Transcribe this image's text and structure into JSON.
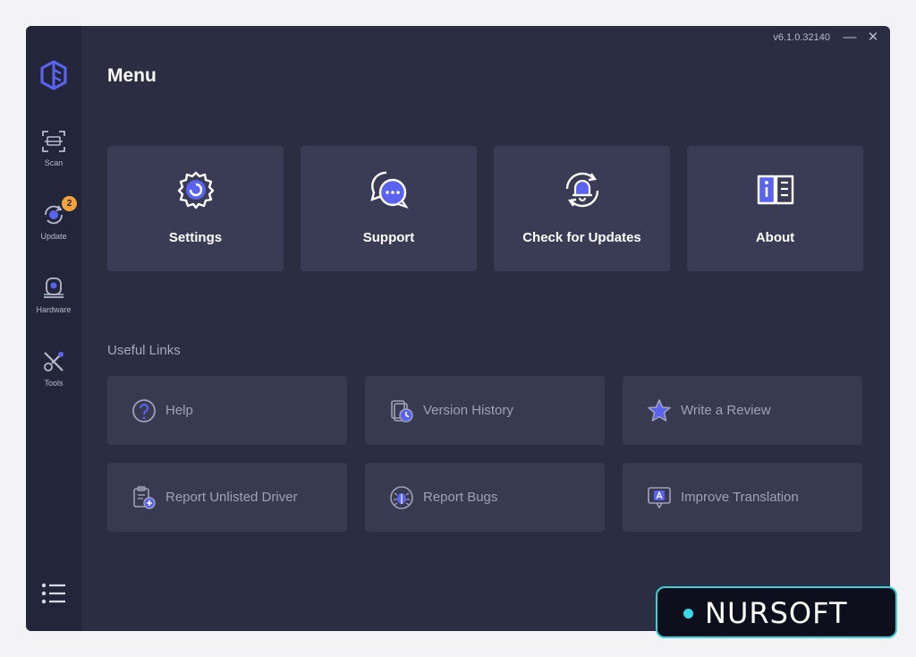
{
  "app": {
    "version": "v6.1.0.32140",
    "accent": "#5a63f0",
    "badge_color": "#f2a33a"
  },
  "sidebar": {
    "items": [
      {
        "label": "Scan",
        "icon": "scan-icon"
      },
      {
        "label": "Update",
        "icon": "update-icon",
        "badge": "2"
      },
      {
        "label": "Hardware",
        "icon": "hardware-icon"
      },
      {
        "label": "Tools",
        "icon": "tools-icon"
      }
    ],
    "menu_icon": "menu-list-icon"
  },
  "window": {
    "minimize": "—",
    "close": "✕"
  },
  "main": {
    "title": "Menu",
    "cards": [
      {
        "label": "Settings",
        "icon": "gear-icon"
      },
      {
        "label": "Support",
        "icon": "chat-icon"
      },
      {
        "label": "Check for Updates",
        "icon": "bell-refresh-icon"
      },
      {
        "label": "About",
        "icon": "book-info-icon"
      }
    ],
    "useful_links_title": "Useful Links",
    "links": [
      {
        "label": "Help",
        "icon": "help-icon"
      },
      {
        "label": "Version History",
        "icon": "history-icon"
      },
      {
        "label": "Write a Review",
        "icon": "star-icon"
      },
      {
        "label": "Report Unlisted Driver",
        "icon": "clipboard-add-icon"
      },
      {
        "label": "Report Bugs",
        "icon": "bug-icon"
      },
      {
        "label": "Improve Translation",
        "icon": "translate-icon"
      }
    ]
  },
  "watermark": {
    "text": "NURSOFT"
  }
}
